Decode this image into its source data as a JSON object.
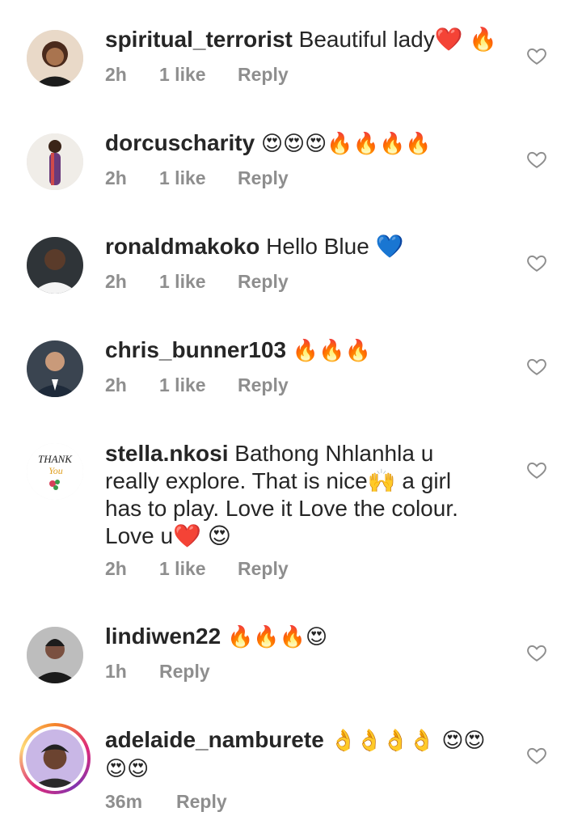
{
  "colors": {
    "meta": "#8e8e8e",
    "text": "#262626",
    "heart_stroke": "#8e8e8e"
  },
  "comments": [
    {
      "username": "spiritual_terrorist",
      "text": "Beautiful lady❤️ 🔥",
      "time": "2h",
      "likes": "1 like",
      "reply": "Reply"
    },
    {
      "username": "dorcuscharity",
      "text": "😍😍😍🔥🔥🔥🔥",
      "time": "2h",
      "likes": "1 like",
      "reply": "Reply"
    },
    {
      "username": "ronaldmakoko",
      "text": "Hello Blue 💙",
      "time": "2h",
      "likes": "1 like",
      "reply": "Reply"
    },
    {
      "username": "chris_bunner103",
      "text": "🔥🔥🔥",
      "time": "2h",
      "likes": "1 like",
      "reply": "Reply"
    },
    {
      "username": "stella.nkosi",
      "text": "Bathong Nhlanhla u really explore. That is nice🙌 a girl has to play. Love it Love the colour. Love u❤️ 😍",
      "time": "2h",
      "likes": "1 like",
      "reply": "Reply",
      "avatar_text": [
        "THANK",
        "You"
      ]
    },
    {
      "username": "lindiwen22",
      "text": "🔥🔥🔥😍",
      "time": "1h",
      "likes": "",
      "reply": "Reply"
    },
    {
      "username": "adelaide_namburete",
      "text": "👌👌👌👌 😍😍 😍😍",
      "time": "36m",
      "likes": "",
      "reply": "Reply"
    }
  ]
}
